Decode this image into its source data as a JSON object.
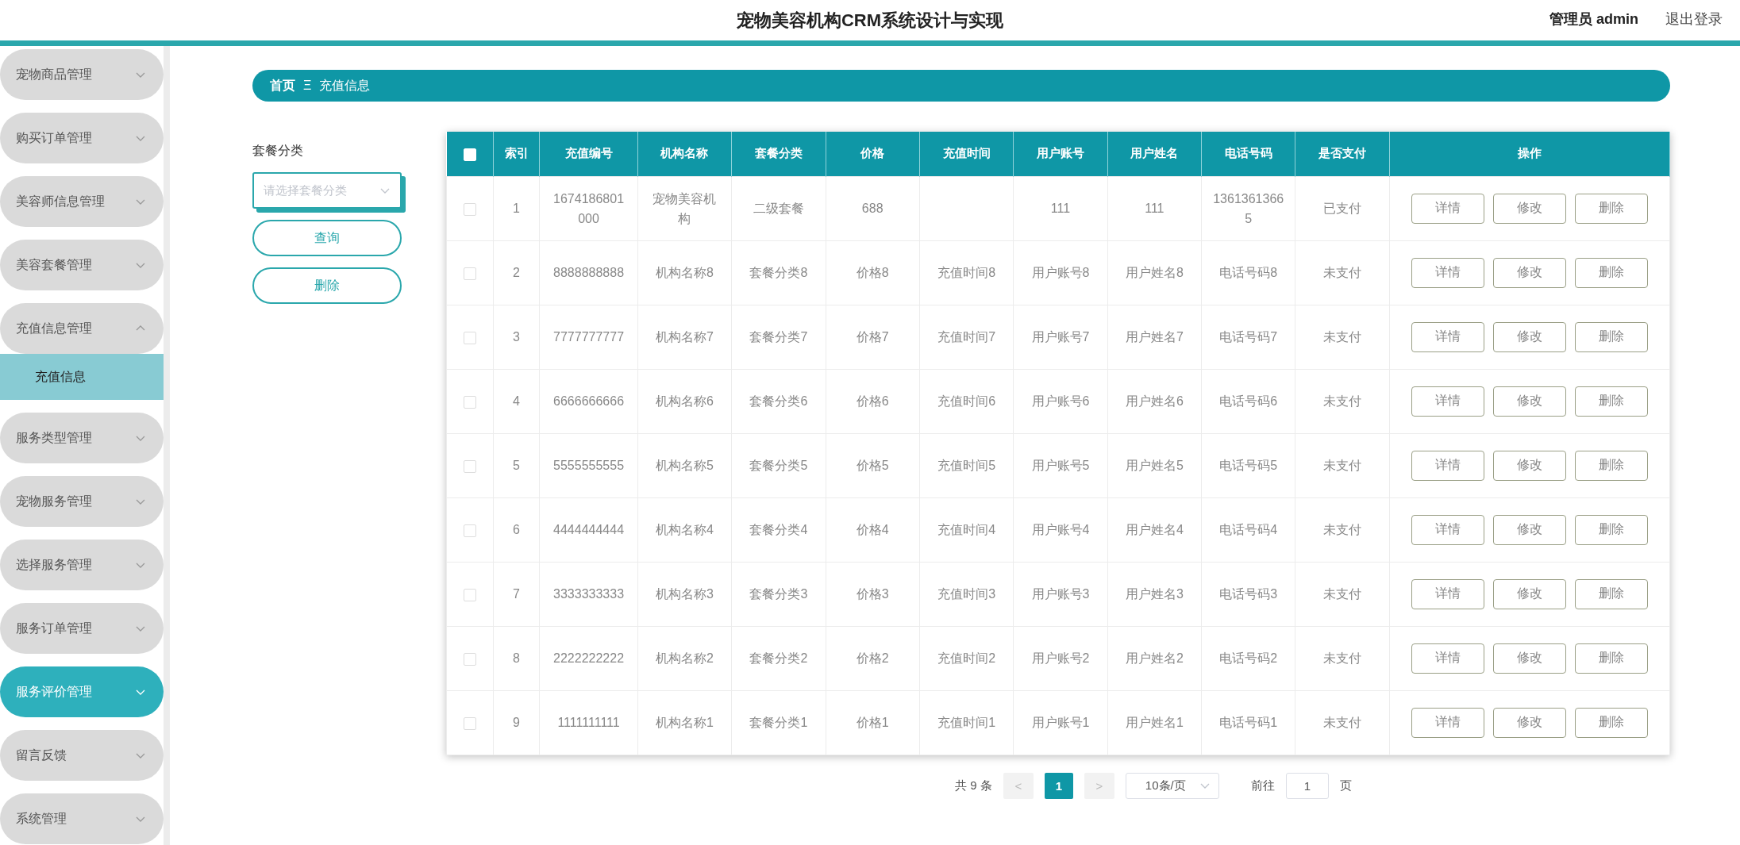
{
  "header": {
    "title": "宠物美容机构CRM系统设计与实现",
    "user": "管理员 admin",
    "logout": "退出登录"
  },
  "sidebar": {
    "items": [
      {
        "label": "宠物商品管理",
        "expanded": false,
        "selected": false
      },
      {
        "label": "购买订单管理",
        "expanded": false,
        "selected": false
      },
      {
        "label": "美容师信息管理",
        "expanded": false,
        "selected": false
      },
      {
        "label": "美容套餐管理",
        "expanded": false,
        "selected": false
      },
      {
        "label": "充值信息管理",
        "expanded": true,
        "selected": false,
        "children": [
          {
            "label": "充值信息",
            "selected": true
          }
        ]
      },
      {
        "label": "服务类型管理",
        "expanded": false,
        "selected": false
      },
      {
        "label": "宠物服务管理",
        "expanded": false,
        "selected": false
      },
      {
        "label": "选择服务管理",
        "expanded": false,
        "selected": false
      },
      {
        "label": "服务订单管理",
        "expanded": false,
        "selected": false
      },
      {
        "label": "服务评价管理",
        "expanded": false,
        "selected": true
      },
      {
        "label": "留言反馈",
        "expanded": false,
        "selected": false
      },
      {
        "label": "系统管理",
        "expanded": false,
        "selected": false
      }
    ]
  },
  "breadcrumb": {
    "home": "首页",
    "separator": "Ξ",
    "current": "充值信息"
  },
  "filter": {
    "label": "套餐分类",
    "placeholder": "请选择套餐分类",
    "buttons": [
      "查询",
      "删除"
    ]
  },
  "table": {
    "header_checked": false,
    "columns": [
      "索引",
      "充值编号",
      "机构名称",
      "套餐分类",
      "价格",
      "充值时间",
      "用户账号",
      "用户姓名",
      "电话号码",
      "是否支付",
      "操作"
    ],
    "rows": [
      {
        "checked": false,
        "cells": [
          "1",
          "1674186801000",
          "宠物美容机构",
          "二级套餐",
          "688",
          "",
          "111",
          "111",
          "13613613665",
          "已支付"
        ],
        "actions": [
          "详情",
          "修改",
          "删除"
        ]
      },
      {
        "checked": false,
        "cells": [
          "2",
          "8888888888",
          "机构名称8",
          "套餐分类8",
          "价格8",
          "充值时间8",
          "用户账号8",
          "用户姓名8",
          "电话号码8",
          "未支付"
        ],
        "actions": [
          "详情",
          "修改",
          "删除"
        ]
      },
      {
        "checked": false,
        "cells": [
          "3",
          "7777777777",
          "机构名称7",
          "套餐分类7",
          "价格7",
          "充值时间7",
          "用户账号7",
          "用户姓名7",
          "电话号码7",
          "未支付"
        ],
        "actions": [
          "详情",
          "修改",
          "删除"
        ]
      },
      {
        "checked": false,
        "cells": [
          "4",
          "6666666666",
          "机构名称6",
          "套餐分类6",
          "价格6",
          "充值时间6",
          "用户账号6",
          "用户姓名6",
          "电话号码6",
          "未支付"
        ],
        "actions": [
          "详情",
          "修改",
          "删除"
        ]
      },
      {
        "checked": false,
        "cells": [
          "5",
          "5555555555",
          "机构名称5",
          "套餐分类5",
          "价格5",
          "充值时间5",
          "用户账号5",
          "用户姓名5",
          "电话号码5",
          "未支付"
        ],
        "actions": [
          "详情",
          "修改",
          "删除"
        ]
      },
      {
        "checked": false,
        "cells": [
          "6",
          "4444444444",
          "机构名称4",
          "套餐分类4",
          "价格4",
          "充值时间4",
          "用户账号4",
          "用户姓名4",
          "电话号码4",
          "未支付"
        ],
        "actions": [
          "详情",
          "修改",
          "删除"
        ]
      },
      {
        "checked": false,
        "cells": [
          "7",
          "3333333333",
          "机构名称3",
          "套餐分类3",
          "价格3",
          "充值时间3",
          "用户账号3",
          "用户姓名3",
          "电话号码3",
          "未支付"
        ],
        "actions": [
          "详情",
          "修改",
          "删除"
        ]
      },
      {
        "checked": false,
        "cells": [
          "8",
          "2222222222",
          "机构名称2",
          "套餐分类2",
          "价格2",
          "充值时间2",
          "用户账号2",
          "用户姓名2",
          "电话号码2",
          "未支付"
        ],
        "actions": [
          "详情",
          "修改",
          "删除"
        ]
      },
      {
        "checked": false,
        "cells": [
          "9",
          "1111111111",
          "机构名称1",
          "套餐分类1",
          "价格1",
          "充值时间1",
          "用户账号1",
          "用户姓名1",
          "电话号码1",
          "未支付"
        ],
        "actions": [
          "详情",
          "修改",
          "删除"
        ]
      }
    ]
  },
  "pagination": {
    "total": "共 9 条",
    "prev": "<",
    "pages": [
      {
        "label": "1",
        "selected": true
      }
    ],
    "next": ">",
    "page_size": "10条/页",
    "goto_label": "前往",
    "goto_value": "1",
    "goto_suffix": "页"
  }
}
